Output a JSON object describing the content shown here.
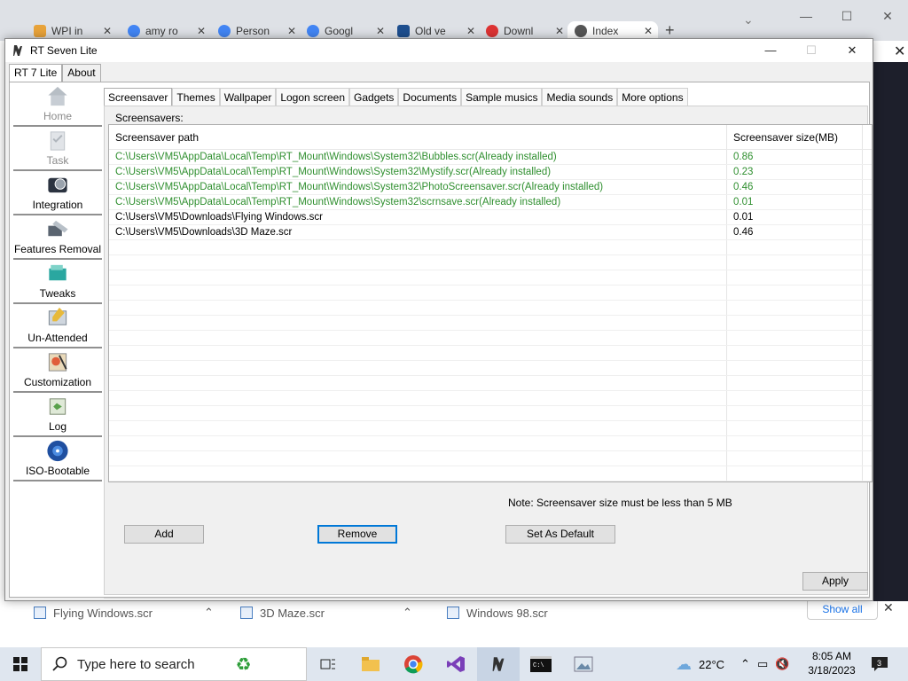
{
  "browser": {
    "tabs": [
      {
        "label": "WPI in",
        "favicon": "wpi-icon",
        "color": "#e8a33a"
      },
      {
        "label": "amy ro",
        "favicon": "google-icon",
        "color": "#4285f4"
      },
      {
        "label": "Person",
        "favicon": "google-icon",
        "color": "#4285f4"
      },
      {
        "label": "Googl",
        "favicon": "google-icon",
        "color": "#4285f4"
      },
      {
        "label": "Old ve",
        "favicon": "ov-icon",
        "color": "#1e4f8f"
      },
      {
        "label": "Downl",
        "favicon": "download-site-icon",
        "color": "#d33"
      },
      {
        "label": "Index",
        "favicon": "globe-icon",
        "color": "#555"
      }
    ],
    "new_tab": "+",
    "downloads": [
      {
        "label": "Flying Windows.scr"
      },
      {
        "label": "3D Maze.scr"
      },
      {
        "label": "Windows 98.scr"
      }
    ],
    "show_all": "Show all"
  },
  "app": {
    "title": "RT Seven Lite",
    "main_tabs": [
      "RT 7 Lite",
      "About"
    ],
    "nav": [
      {
        "label": "Home",
        "icon": "home-icon",
        "dim": true
      },
      {
        "label": "Task",
        "icon": "task-icon",
        "dim": true
      },
      {
        "label": "Integration",
        "icon": "integration-icon",
        "dim": false
      },
      {
        "label": "Features Removal",
        "icon": "features-removal-icon",
        "dim": false
      },
      {
        "label": "Tweaks",
        "icon": "tweaks-icon",
        "dim": false
      },
      {
        "label": "Un-Attended",
        "icon": "unattended-icon",
        "dim": false
      },
      {
        "label": "Customization",
        "icon": "customization-icon",
        "dim": false
      },
      {
        "label": "Log",
        "icon": "log-icon",
        "dim": false
      },
      {
        "label": "ISO-Bootable",
        "icon": "iso-bootable-icon",
        "dim": false
      }
    ],
    "sub_tabs": [
      "Screensaver",
      "Themes",
      "Wallpaper",
      "Logon screen",
      "Gadgets",
      "Documents",
      "Sample musics",
      "Media sounds",
      "More options"
    ],
    "screensavers_label": "Screensavers:",
    "columns": [
      "Screensaver path",
      "Screensaver size(MB)"
    ],
    "rows": [
      {
        "path": "C:\\Users\\VM5\\AppData\\Local\\Temp\\RT_Mount\\Windows\\System32\\Bubbles.scr(Already installed)",
        "size": "0.86",
        "installed": true
      },
      {
        "path": "C:\\Users\\VM5\\AppData\\Local\\Temp\\RT_Mount\\Windows\\System32\\Mystify.scr(Already installed)",
        "size": "0.23",
        "installed": true
      },
      {
        "path": "C:\\Users\\VM5\\AppData\\Local\\Temp\\RT_Mount\\Windows\\System32\\PhotoScreensaver.scr(Already installed)",
        "size": "0.46",
        "installed": true
      },
      {
        "path": "C:\\Users\\VM5\\AppData\\Local\\Temp\\RT_Mount\\Windows\\System32\\scrnsave.scr(Already installed)",
        "size": "0.01",
        "installed": true
      },
      {
        "path": "C:\\Users\\VM5\\Downloads\\Flying Windows.scr",
        "size": "0.01",
        "installed": false
      },
      {
        "path": "C:\\Users\\VM5\\Downloads\\3D Maze.scr",
        "size": "0.46",
        "installed": false
      }
    ],
    "note": "Note: Screensaver size must be less than 5 MB",
    "buttons": {
      "add": "Add",
      "remove": "Remove",
      "set_default": "Set As Default",
      "apply": "Apply"
    },
    "installed_color": "#2f8f2f"
  },
  "taskbar": {
    "search_placeholder": "Type here to search",
    "temperature": "22°C",
    "time": "8:05 AM",
    "date": "3/18/2023",
    "notification_count": "3"
  }
}
